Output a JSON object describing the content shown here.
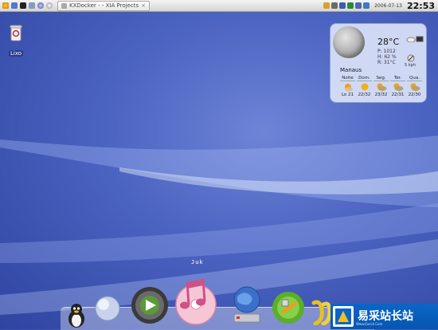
{
  "panel": {
    "task_title": "KXDocker - - XIA Projects",
    "task_close": "×",
    "date": "2006-07-13",
    "clock": "22:53",
    "quicklaunch_icons": [
      "kmenu-icon",
      "desktop-icon",
      "terminal-icon",
      "home-icon",
      "browser-icon",
      "help-icon"
    ],
    "tray_icons": [
      "network-icon",
      "volume-icon",
      "speaker-icon",
      "update-icon",
      "printer-icon",
      "battery-icon"
    ]
  },
  "desktop": {
    "trash_label": "Lixo"
  },
  "weather": {
    "temperature": "28°C",
    "pressure": "P: 1012",
    "humidity": "H: 62 %",
    "real_feel": "R: 31°C",
    "wind": "5 kph",
    "city": "Manaus",
    "forecast": [
      {
        "day": "Noite",
        "range": "Lo 21"
      },
      {
        "day": "Dom.",
        "range": "22/32"
      },
      {
        "day": "Seg.",
        "range": "23/32"
      },
      {
        "day": "Ter.",
        "range": "22/31"
      },
      {
        "day": "Qua.",
        "range": "22/30"
      }
    ]
  },
  "dock": {
    "hover_label": "Juk",
    "items": [
      "tux-icon",
      "ball-icon",
      "media-player-icon",
      "juk-music-icon",
      "network-globe-icon",
      "tools-icon",
      "partial-item-icon"
    ]
  },
  "watermark": {
    "text": "易采站长站",
    "sub": "Www.Easck.Com"
  },
  "colors": {
    "wallpaper": "#4a62c0",
    "panel": "#dcdcdc",
    "watermark": "#0a66c8"
  }
}
